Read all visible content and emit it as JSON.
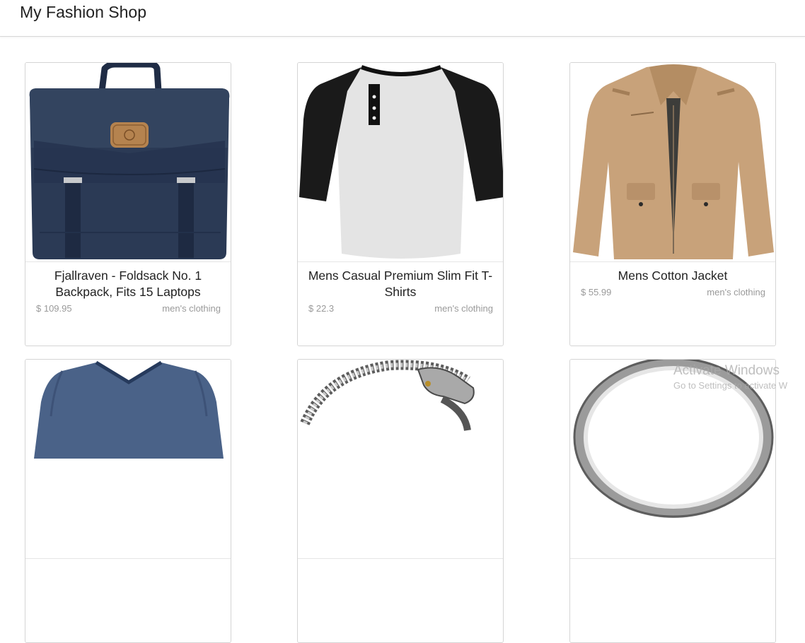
{
  "header": {
    "title": "My Fashion Shop"
  },
  "products": [
    {
      "title": "Fjallraven - Foldsack No. 1 Backpack, Fits 15 Laptops",
      "price": "$ 109.95",
      "category": "men's clothing",
      "image_icon": "backpack-icon"
    },
    {
      "title": "Mens Casual Premium Slim Fit T-Shirts",
      "price": "$ 22.3",
      "category": "men's clothing",
      "image_icon": "raglan-tshirt-icon"
    },
    {
      "title": "Mens Cotton Jacket",
      "price": "$ 55.99",
      "category": "men's clothing",
      "image_icon": "jacket-icon"
    },
    {
      "image_icon": "vneck-tshirt-icon"
    },
    {
      "image_icon": "dragon-bracelet-icon"
    },
    {
      "image_icon": "silver-ring-icon"
    }
  ],
  "watermark": {
    "line1": "Activate Windows",
    "line2": "Go to Settings to activate W"
  },
  "colors": {
    "card_border": "#d5d5d5",
    "muted_text": "#9a9a9a",
    "backpack_navy": "#2b3a55",
    "jacket_tan": "#c8a27a"
  }
}
